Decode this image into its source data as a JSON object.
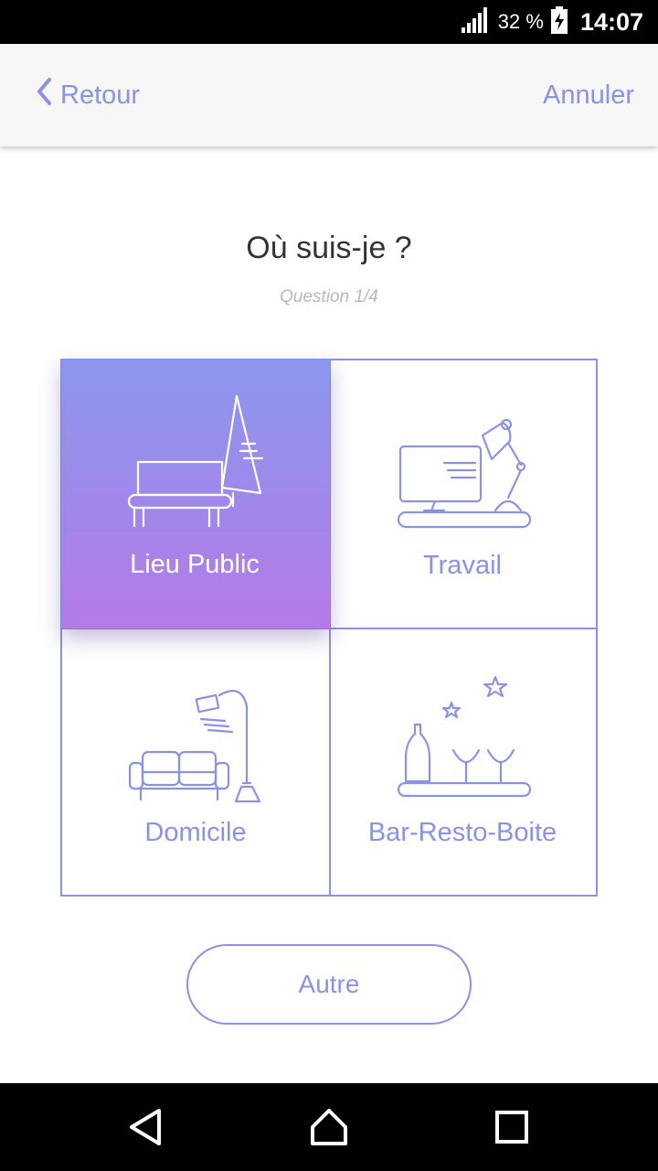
{
  "status_bar": {
    "battery_percent": "32 %",
    "time": "14:07",
    "icons": [
      "signal-icon",
      "battery-charging-icon"
    ]
  },
  "header": {
    "back_label": "Retour",
    "cancel_label": "Annuler"
  },
  "question": {
    "title": "Où suis-je ?",
    "counter": "Question 1/4"
  },
  "options": [
    {
      "label": "Lieu Public",
      "icon": "bench-tree-icon",
      "selected": true
    },
    {
      "label": "Travail",
      "icon": "desk-computer-icon",
      "selected": false
    },
    {
      "label": "Domicile",
      "icon": "sofa-lamp-icon",
      "selected": false
    },
    {
      "label": "Bar-Resto-Boite",
      "icon": "bottle-glasses-icon",
      "selected": false
    }
  ],
  "other_button": {
    "label": "Autre"
  },
  "system_nav": {
    "buttons": [
      "back-triangle-icon",
      "home-icon",
      "recents-icon"
    ]
  },
  "colors": {
    "accent": "#8a92e8",
    "gradient_top": "#8b97ec",
    "gradient_bottom": "#b47ae8"
  }
}
